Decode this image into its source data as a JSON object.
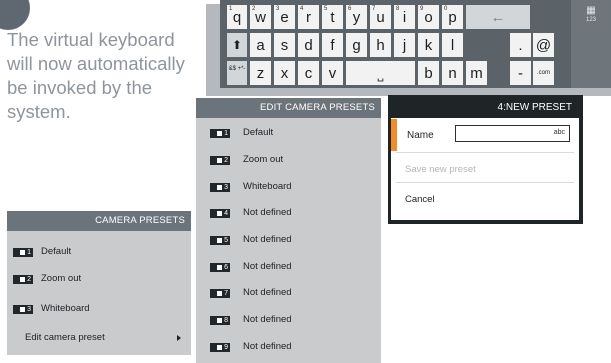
{
  "instruction": "The virtual keyboard will now automatically be invoked by the system.",
  "keyboard": {
    "row1": [
      {
        "key": "q",
        "sup": "1"
      },
      {
        "key": "w",
        "sup": "2"
      },
      {
        "key": "e",
        "sup": "3"
      },
      {
        "key": "r",
        "sup": "4"
      },
      {
        "key": "t",
        "sup": "5"
      },
      {
        "key": "y",
        "sup": "6"
      },
      {
        "key": "u",
        "sup": "7"
      },
      {
        "key": "i",
        "sup": "8"
      },
      {
        "key": "o",
        "sup": "9"
      },
      {
        "key": "p",
        "sup": "0"
      }
    ],
    "backspace": "←",
    "shift": "⬆",
    "row2": [
      "a",
      "s",
      "d",
      "f",
      "g",
      "h",
      "j",
      "k",
      "l"
    ],
    "period": ".",
    "at": "@",
    "symbols": "&$ +*-",
    "row3a": [
      "z",
      "x",
      "c",
      "v"
    ],
    "space": "⎵",
    "row3b": [
      "b",
      "n",
      "m"
    ],
    "dash": "-",
    "dotcom": ".com",
    "mode_icon": "grid-icon",
    "mode_label": "123"
  },
  "camera_presets": {
    "header": "CAMERA PRESETS",
    "items": [
      {
        "num": "1",
        "label": "Default"
      },
      {
        "num": "2",
        "label": "Zoom out"
      },
      {
        "num": "3",
        "label": "Whiteboard"
      }
    ],
    "edit_label": "Edit camera preset"
  },
  "edit_presets": {
    "header": "EDIT CAMERA PRESETS",
    "items": [
      {
        "num": "1",
        "label": "Default"
      },
      {
        "num": "2",
        "label": "Zoom out"
      },
      {
        "num": "3",
        "label": "Whiteboard"
      },
      {
        "num": "4",
        "label": "Not defined"
      },
      {
        "num": "5",
        "label": "Not defined"
      },
      {
        "num": "6",
        "label": "Not defined"
      },
      {
        "num": "7",
        "label": "Not defined"
      },
      {
        "num": "8",
        "label": "Not defined"
      },
      {
        "num": "9",
        "label": "Not defined"
      }
    ]
  },
  "new_preset": {
    "header": "4:NEW PRESET",
    "name_label": "Name",
    "input_value": "",
    "input_mode": "abc",
    "save_label": "Save new preset",
    "cancel_label": "Cancel"
  },
  "colors": {
    "accent": "#f28c28",
    "header": "#6c747b",
    "panel": "#c9cbcd"
  }
}
